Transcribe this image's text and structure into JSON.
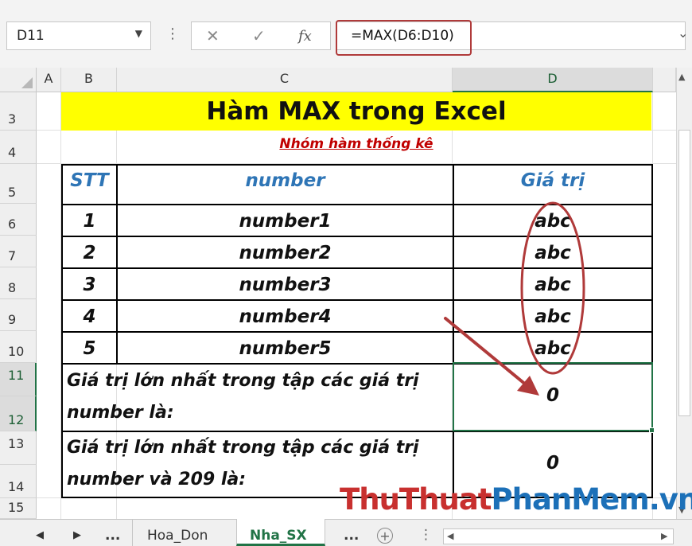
{
  "formula_bar": {
    "name_box": "D11",
    "cancel_icon": "✕",
    "enter_icon": "✓",
    "fx_label": "fx",
    "formula": "=MAX(D6:D10)"
  },
  "columns": [
    "A",
    "B",
    "C",
    "D"
  ],
  "rows": [
    "3",
    "4",
    "5",
    "6",
    "7",
    "8",
    "9",
    "10",
    "11",
    "12",
    "13",
    "14",
    "15"
  ],
  "sheet": {
    "title": "Hàm MAX trong Excel",
    "subtitle": "Nhóm hàm thống kê",
    "headers": {
      "stt": "STT",
      "number": "number",
      "value": "Giá trị"
    },
    "data_rows": [
      {
        "stt": "1",
        "number": "number1",
        "value": "abc"
      },
      {
        "stt": "2",
        "number": "number2",
        "value": "abc"
      },
      {
        "stt": "3",
        "number": "number3",
        "value": "abc"
      },
      {
        "stt": "4",
        "number": "number4",
        "value": "abc"
      },
      {
        "stt": "5",
        "number": "number5",
        "value": "abc"
      }
    ],
    "summary1": {
      "line1": "Giá trị lớn nhất trong tập các giá trị",
      "line2": "number là:",
      "result": "0"
    },
    "summary2": {
      "line1": "Giá trị lớn nhất trong tập các giá trị",
      "line2": "number và 209 là:",
      "result": "0"
    }
  },
  "tabs": {
    "ellipsis_left": "...",
    "sheets": [
      "Hoa_Don",
      "Nha_SX"
    ],
    "active": "Nha_SX",
    "ellipsis_right": "..."
  },
  "watermark": {
    "part1": "ThuThuat",
    "part2": "PhanMem",
    "part3": ".vn"
  },
  "colors": {
    "title_fill": "#ffff00",
    "header_text": "#2e75b6",
    "subtitle_text": "#c00000",
    "selection": "#217346",
    "annotation": "#b03a3a"
  }
}
